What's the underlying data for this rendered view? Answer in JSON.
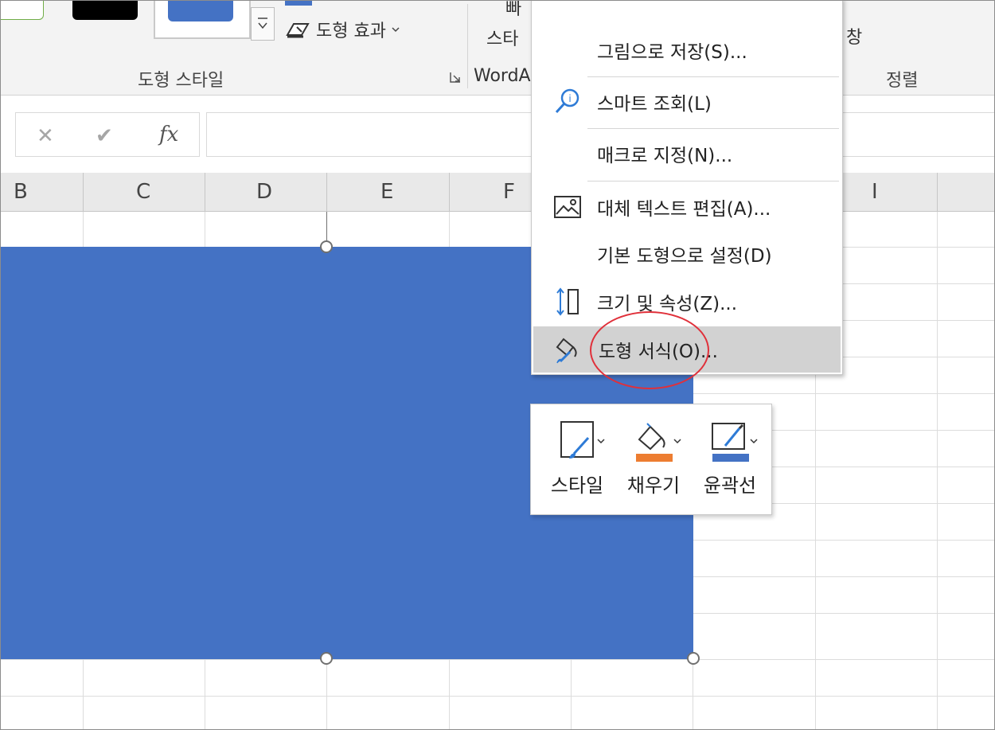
{
  "ribbon": {
    "shape_effect_label": "도형 효과",
    "shape_style_group": "도형 스타일",
    "wordart_fragment": "WordA",
    "wordart_top_fragment": "빠",
    "wordart_style_fragment": "스타",
    "arrange_window_fragment": "창",
    "arrange_group": "정렬"
  },
  "formula_bar": {
    "cancel_glyph": "✕",
    "enter_glyph": "✔",
    "fx_label": "fx",
    "value": ""
  },
  "columns": [
    "B",
    "C",
    "D",
    "E",
    "F",
    "I"
  ],
  "context_menu": {
    "items": [
      {
        "label": "그림으로 저장(S)...",
        "icon": ""
      },
      {
        "label": "스마트 조회(L)",
        "icon": "smart-lookup-icon"
      },
      {
        "label": "매크로 지정(N)...",
        "icon": ""
      },
      {
        "label": "대체 텍스트 편집(A)...",
        "icon": "alt-text-icon"
      },
      {
        "label": "기본 도형으로 설정(D)",
        "icon": ""
      },
      {
        "label": "크기 및 속성(Z)...",
        "icon": "size-properties-icon"
      },
      {
        "label": "도형 서식(O)...",
        "icon": "format-shape-icon",
        "highlighted": true
      }
    ]
  },
  "mini_toolbar": {
    "style_label": "스타일",
    "fill_label": "채우기",
    "outline_label": "윤곽선",
    "fill_color": "#ed7d31",
    "outline_color": "#4472c4"
  },
  "colors": {
    "shape_fill": "#4472c4",
    "menu_highlight": "#d2d2d2",
    "annotation_circle": "#e0303a",
    "icon_accent": "#2e7bd6"
  }
}
